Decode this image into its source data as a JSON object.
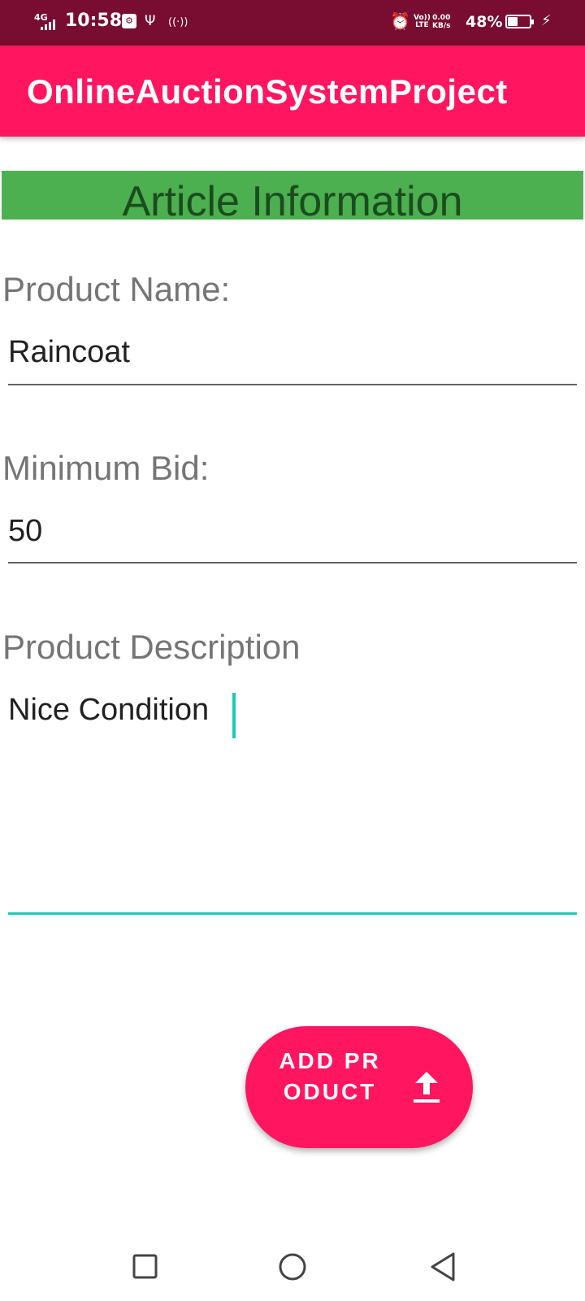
{
  "status_bar": {
    "network": "4G",
    "time": "10:58",
    "volte_lines": [
      "Vo))",
      "LTE"
    ],
    "data_rate_lines": [
      "0.00",
      "KB/s"
    ],
    "battery_percent": "48%",
    "battery_level": 0.48,
    "icons": [
      "signal-icon",
      "usb-debug-icon",
      "usb-icon",
      "hotspot-icon",
      "alarm-icon",
      "volte-icon",
      "battery-icon",
      "charging-icon"
    ]
  },
  "app_bar": {
    "title": "OnlineAuctionSystemProject"
  },
  "section": {
    "title": "Article Information"
  },
  "form": {
    "product_name": {
      "label": "Product Name:",
      "value": "Raincoat"
    },
    "minimum_bid": {
      "label": "Minimum Bid:",
      "value": "50"
    },
    "product_description": {
      "label": "Product Description",
      "value": "Nice Condition"
    }
  },
  "fab": {
    "label": "ADD PRODUCT",
    "icon": "upload-icon"
  },
  "nav_bar": {
    "buttons": [
      "recents-icon",
      "home-icon",
      "back-icon"
    ]
  },
  "colors": {
    "status_bar": "#780d31",
    "accent": "#ff1560",
    "section_bg": "#4caf50",
    "focus": "#1ec8b5"
  }
}
